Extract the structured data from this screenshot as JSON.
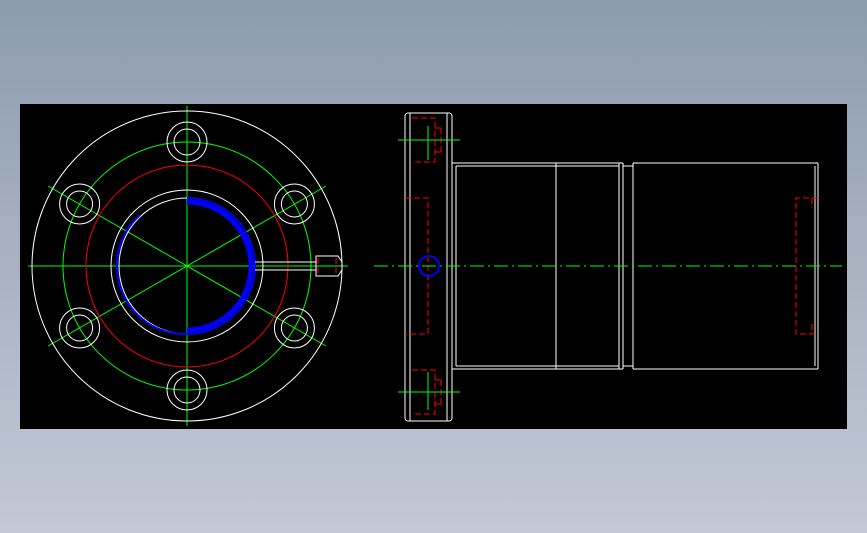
{
  "drawing": {
    "colors": {
      "background": "#000000",
      "outline": "#ffffff",
      "centerline": "#00ff00",
      "hidden": "#ff0000",
      "seal": "#0000ff"
    },
    "views": [
      {
        "name": "front-view-flange"
      },
      {
        "name": "side-view-bushing"
      }
    ]
  }
}
